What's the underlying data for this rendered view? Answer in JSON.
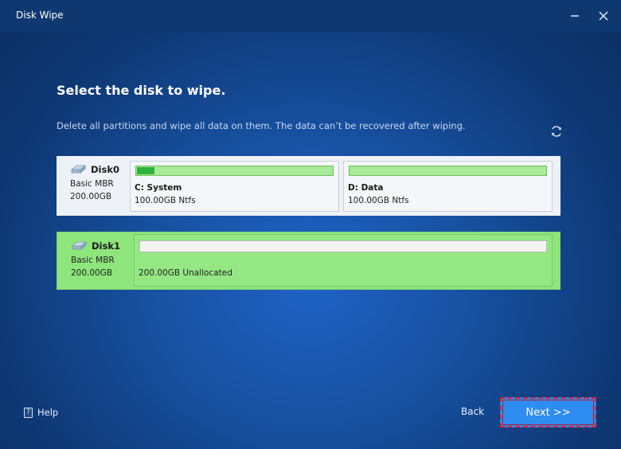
{
  "window": {
    "title": "Disk Wipe"
  },
  "header": {
    "title": "Select the disk to wipe.",
    "subtitle": "Delete all partitions and wipe all data on them. The data can’t be recovered after wiping."
  },
  "disks": [
    {
      "name": "Disk0",
      "type": "Basic MBR",
      "size": "200.00GB",
      "partitions": [
        {
          "label": "C: System",
          "detail": "100.00GB Ntfs",
          "used_fraction": 0.09
        },
        {
          "label": "D: Data",
          "detail": "100.00GB Ntfs",
          "used_fraction": 0.0
        }
      ]
    },
    {
      "name": "Disk1",
      "type": "Basic MBR",
      "size": "200.00GB",
      "partitions": [
        {
          "detail": "200.00GB Unallocated"
        }
      ],
      "selected": true
    }
  ],
  "footer": {
    "help_label": "Help",
    "back_label": "Back",
    "next_label": "Next >>"
  },
  "icons": {
    "minimize": "minimize-icon",
    "close": "close-icon",
    "refresh": "refresh-icon",
    "disk": "disk-icon",
    "help": "help-icon"
  },
  "colors": {
    "selected_row": "#8de57c",
    "next_button": "#2f8cf0",
    "highlight_border": "#d7263d"
  }
}
